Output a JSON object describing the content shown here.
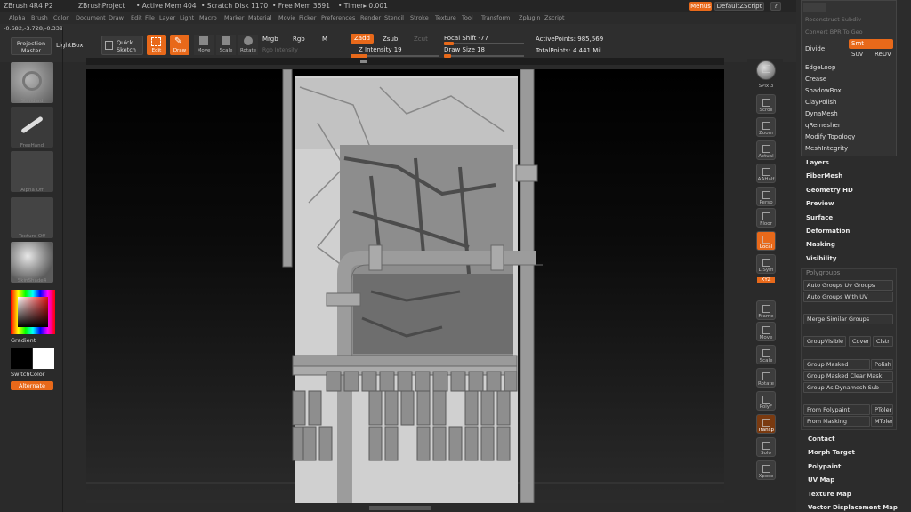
{
  "titlebar": {
    "app": "ZBrush 4R4 P2",
    "project": "ZBrushProject",
    "active_mem": "• Active Mem 404",
    "scratch": "• Scratch Disk 1170",
    "free_mem": "• Free Mem 3691",
    "timer": "• Timer▸ 0.001",
    "menus_btn": "Menus",
    "script_btn": "DefaultZScript"
  },
  "menubar": [
    "Alpha",
    "Brush",
    "Color",
    "Document",
    "Draw",
    "Edit",
    "File",
    "Layer",
    "Light",
    "Macro",
    "Marker",
    "Material",
    "Movie",
    "Picker",
    "Preferences",
    "Render",
    "Stencil",
    "Stroke",
    "Texture",
    "Tool",
    "Transform",
    "Zplugin",
    "Zscript"
  ],
  "coords": "-0.682,-3.728,-0.339",
  "toolbar": {
    "projection_master": "Projection Master",
    "lightbox": "LightBox",
    "quick_sketch": "Quick Sketch",
    "edit": "Edit",
    "draw": "Draw",
    "move": "Move",
    "scale": "Scale",
    "rotate": "Rotate",
    "mrgb": "Mrgb",
    "rgb": "Rgb",
    "m": "M",
    "rgb_intensity": "Rgb Intensity",
    "zadd": "Zadd",
    "zsub": "Zsub",
    "zcut": "Zcut",
    "z_intensity": "Z Intensity 19",
    "focal_shift": "Focal Shift -77",
    "draw_size": "Draw Size 18",
    "active_points": "ActivePoints: 985,569",
    "total_points": "TotalPoints: 4.441 Mil",
    "z_intensity_level": 0.19,
    "focal_shift_level": 0.12,
    "draw_size_level": 0.09
  },
  "leftshelf": {
    "brush_label": "Standard",
    "stroke_label": "FreeHand",
    "alpha_label": "Alpha Off",
    "texture_label": "Texture Off",
    "material_label": "SkinShade4",
    "gradient": "Gradient",
    "switch_color": "SwitchColor",
    "alternate": "Alternate"
  },
  "rightshelf": [
    {
      "name": "bpr",
      "label": "BPR"
    },
    {
      "name": "spix",
      "label": "SPix 3"
    },
    {
      "name": "scroll",
      "label": "Scroll"
    },
    {
      "name": "zoom",
      "label": "Zoom"
    },
    {
      "name": "actual",
      "label": "Actual"
    },
    {
      "name": "aahalf",
      "label": "AAHalf"
    },
    {
      "name": "persp",
      "label": "Persp"
    },
    {
      "name": "floor",
      "label": "Floor"
    },
    {
      "name": "local",
      "label": "Local"
    },
    {
      "name": "lsym",
      "label": "L.Sym"
    },
    {
      "name": "xyz",
      "label": "XYZ"
    },
    {
      "name": "frame",
      "label": "Frame"
    },
    {
      "name": "move",
      "label": "Move"
    },
    {
      "name": "scale",
      "label": "Scale"
    },
    {
      "name": "rotate",
      "label": "Rotate"
    },
    {
      "name": "polyf",
      "label": "PolyF"
    },
    {
      "name": "transp",
      "label": "Transp"
    },
    {
      "name": "solo",
      "label": "Solo"
    },
    {
      "name": "xpose",
      "label": "Xpose"
    }
  ],
  "panel": {
    "subdiv_top": "Reconstruct Subdiv",
    "convert_bpr": "Convert BPR To Geo",
    "divide": "Divide",
    "smt": "Smt",
    "suv": "Suv",
    "reuv": "ReUV",
    "sections": [
      "EdgeLoop",
      "Crease",
      "ShadowBox",
      "ClayPolish",
      "DynaMesh",
      "qRemesher",
      "Modify Topology",
      "MeshIntegrity"
    ],
    "subpalettes": [
      "Layers",
      "FiberMesh",
      "Geometry HD",
      "Preview",
      "Surface",
      "Deformation",
      "Masking",
      "Visibility"
    ],
    "polygroups_title": "Polygroups",
    "auto_groups_uv": "Auto Groups  Uv Groups",
    "auto_groups_with_uv": "Auto Groups With UV",
    "merge_similar": "Merge Similar Groups",
    "group_visible": "GroupVisible",
    "coverage": "Cover",
    "clustering": "Clstr",
    "group_masked": "Group Masked",
    "polish": "Polish",
    "group_masked_clear": "Group Masked Clear Mask",
    "group_as_dynamesh": "Group As Dynamesh Sub",
    "from_polypaint": "From Polypaint",
    "ptolerance": "PToler",
    "from_masking": "From Masking",
    "mtolerance": "MToler",
    "bottom": [
      "Contact",
      "Morph Target",
      "Polypaint",
      "UV Map",
      "Texture Map",
      "Vector Displacement Map"
    ]
  },
  "colors": {
    "accent": "#e8691a",
    "bg": "#2a2a2a",
    "panel": "#2c2c2c"
  }
}
